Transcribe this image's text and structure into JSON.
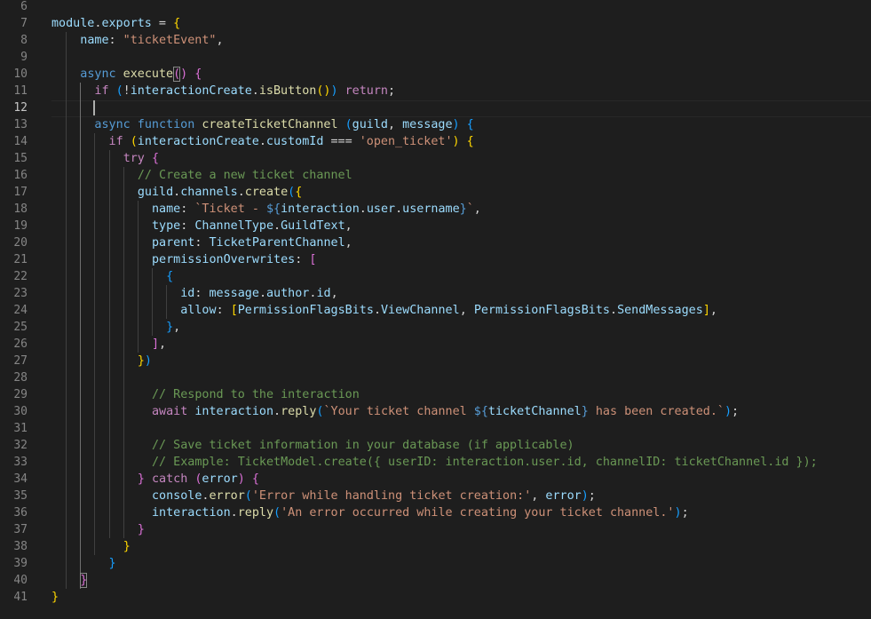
{
  "editor": {
    "theme_colors": {
      "background": "#1e1e1e",
      "keyword": "#569cd6",
      "control": "#c586c0",
      "function": "#dcdcaa",
      "string": "#ce9178",
      "variable": "#9cdcfe",
      "class": "#4ec9b0",
      "comment": "#6a9955",
      "bracket_level_1": "#ffd700",
      "bracket_level_2": "#da70d6",
      "bracket_level_3": "#179fff"
    },
    "active_line": 12,
    "lines": [
      {
        "n": "6",
        "indent": 0,
        "tokens": []
      },
      {
        "n": "7",
        "indent": 0,
        "tokens": [
          [
            "var",
            "module"
          ],
          [
            "op",
            "."
          ],
          [
            "var",
            "exports"
          ],
          [
            "op",
            " = "
          ],
          [
            "b1",
            "{"
          ]
        ]
      },
      {
        "n": "8",
        "indent": 4,
        "tokens": [
          [
            "var",
            "name"
          ],
          [
            "op",
            ": "
          ],
          [
            "str",
            "\"ticketEvent\""
          ],
          [
            "op",
            ","
          ]
        ]
      },
      {
        "n": "9",
        "indent": 0,
        "tokens": []
      },
      {
        "n": "10",
        "indent": 4,
        "tokens": [
          [
            "kw",
            "async"
          ],
          [
            "op",
            " "
          ],
          [
            "fn",
            "execute"
          ],
          [
            "b2",
            "()"
          ],
          [
            "op",
            " "
          ],
          [
            "b2",
            "{"
          ]
        ]
      },
      {
        "n": "11",
        "indent": 6,
        "tokens": [
          [
            "ctl",
            "if"
          ],
          [
            "op",
            " "
          ],
          [
            "b3",
            "("
          ],
          [
            "op",
            "!"
          ],
          [
            "var",
            "interactionCreate"
          ],
          [
            "op",
            "."
          ],
          [
            "fn",
            "isButton"
          ],
          [
            "b1",
            "()"
          ],
          [
            "b3",
            ")"
          ],
          [
            "op",
            " "
          ],
          [
            "ctl",
            "return"
          ],
          [
            "op",
            ";"
          ]
        ]
      },
      {
        "n": "12",
        "indent": 0,
        "tokens": []
      },
      {
        "n": "13",
        "indent": 6,
        "tokens": [
          [
            "kw",
            "async"
          ],
          [
            "op",
            " "
          ],
          [
            "kw",
            "function"
          ],
          [
            "op",
            " "
          ],
          [
            "fn",
            "createTicketChannel"
          ],
          [
            "op",
            " "
          ],
          [
            "b3",
            "("
          ],
          [
            "var",
            "guild"
          ],
          [
            "op",
            ", "
          ],
          [
            "var",
            "message"
          ],
          [
            "b3",
            ")"
          ],
          [
            "op",
            " "
          ],
          [
            "b3",
            "{"
          ]
        ]
      },
      {
        "n": "14",
        "indent": 8,
        "tokens": [
          [
            "ctl",
            "if"
          ],
          [
            "op",
            " "
          ],
          [
            "b1",
            "("
          ],
          [
            "var",
            "interactionCreate"
          ],
          [
            "op",
            "."
          ],
          [
            "var",
            "customId"
          ],
          [
            "op",
            " === "
          ],
          [
            "str",
            "'open_ticket'"
          ],
          [
            "b1",
            ")"
          ],
          [
            "op",
            " "
          ],
          [
            "b1",
            "{"
          ]
        ]
      },
      {
        "n": "15",
        "indent": 10,
        "tokens": [
          [
            "ctl",
            "try"
          ],
          [
            "op",
            " "
          ],
          [
            "b2",
            "{"
          ]
        ]
      },
      {
        "n": "16",
        "indent": 12,
        "tokens": [
          [
            "cmt",
            "// Create a new ticket channel"
          ]
        ]
      },
      {
        "n": "17",
        "indent": 12,
        "tokens": [
          [
            "var",
            "guild"
          ],
          [
            "op",
            "."
          ],
          [
            "var",
            "channels"
          ],
          [
            "op",
            "."
          ],
          [
            "fn",
            "create"
          ],
          [
            "b3",
            "("
          ],
          [
            "b1",
            "{"
          ]
        ]
      },
      {
        "n": "18",
        "indent": 14,
        "tokens": [
          [
            "var",
            "name"
          ],
          [
            "op",
            ": "
          ],
          [
            "str",
            "`Ticket - "
          ],
          [
            "kw",
            "${"
          ],
          [
            "var",
            "interaction"
          ],
          [
            "op",
            "."
          ],
          [
            "var",
            "user"
          ],
          [
            "op",
            "."
          ],
          [
            "var",
            "username"
          ],
          [
            "kw",
            "}"
          ],
          [
            "str",
            "`"
          ],
          [
            "op",
            ","
          ]
        ]
      },
      {
        "n": "19",
        "indent": 14,
        "tokens": [
          [
            "var",
            "type"
          ],
          [
            "op",
            ": "
          ],
          [
            "var",
            "ChannelType"
          ],
          [
            "op",
            "."
          ],
          [
            "var",
            "GuildText"
          ],
          [
            "op",
            ","
          ]
        ]
      },
      {
        "n": "20",
        "indent": 14,
        "tokens": [
          [
            "var",
            "parent"
          ],
          [
            "op",
            ": "
          ],
          [
            "var",
            "TicketParentChannel"
          ],
          [
            "op",
            ","
          ]
        ]
      },
      {
        "n": "21",
        "indent": 14,
        "tokens": [
          [
            "var",
            "permissionOverwrites"
          ],
          [
            "op",
            ": "
          ],
          [
            "b2",
            "["
          ]
        ]
      },
      {
        "n": "22",
        "indent": 16,
        "tokens": [
          [
            "b3",
            "{"
          ]
        ]
      },
      {
        "n": "23",
        "indent": 18,
        "tokens": [
          [
            "var",
            "id"
          ],
          [
            "op",
            ": "
          ],
          [
            "var",
            "message"
          ],
          [
            "op",
            "."
          ],
          [
            "var",
            "author"
          ],
          [
            "op",
            "."
          ],
          [
            "var",
            "id"
          ],
          [
            "op",
            ","
          ]
        ]
      },
      {
        "n": "24",
        "indent": 18,
        "tokens": [
          [
            "var",
            "allow"
          ],
          [
            "op",
            ": "
          ],
          [
            "b1",
            "["
          ],
          [
            "var",
            "PermissionFlagsBits"
          ],
          [
            "op",
            "."
          ],
          [
            "var",
            "ViewChannel"
          ],
          [
            "op",
            ", "
          ],
          [
            "var",
            "PermissionFlagsBits"
          ],
          [
            "op",
            "."
          ],
          [
            "var",
            "SendMessages"
          ],
          [
            "b1",
            "]"
          ],
          [
            "op",
            ","
          ]
        ]
      },
      {
        "n": "25",
        "indent": 16,
        "tokens": [
          [
            "b3",
            "}"
          ],
          [
            "op",
            ","
          ]
        ]
      },
      {
        "n": "26",
        "indent": 14,
        "tokens": [
          [
            "b2",
            "]"
          ],
          [
            "op",
            ","
          ]
        ]
      },
      {
        "n": "27",
        "indent": 12,
        "tokens": [
          [
            "b1",
            "}"
          ],
          [
            "b3",
            ")"
          ]
        ]
      },
      {
        "n": "28",
        "indent": 0,
        "tokens": []
      },
      {
        "n": "29",
        "indent": 14,
        "tokens": [
          [
            "cmt",
            "// Respond to the interaction"
          ]
        ]
      },
      {
        "n": "30",
        "indent": 14,
        "tokens": [
          [
            "ctl",
            "await"
          ],
          [
            "op",
            " "
          ],
          [
            "var",
            "interaction"
          ],
          [
            "op",
            "."
          ],
          [
            "fn",
            "reply"
          ],
          [
            "b3",
            "("
          ],
          [
            "str",
            "`Your ticket channel "
          ],
          [
            "kw",
            "${"
          ],
          [
            "var",
            "ticketChannel"
          ],
          [
            "kw",
            "}"
          ],
          [
            "str",
            " has been created.`"
          ],
          [
            "b3",
            ")"
          ],
          [
            "op",
            ";"
          ]
        ]
      },
      {
        "n": "31",
        "indent": 0,
        "tokens": []
      },
      {
        "n": "32",
        "indent": 14,
        "tokens": [
          [
            "cmt",
            "// Save ticket information in your database (if applicable)"
          ]
        ]
      },
      {
        "n": "33",
        "indent": 14,
        "tokens": [
          [
            "cmt",
            "// Example: TicketModel.create({ userID: interaction.user.id, channelID: ticketChannel.id });"
          ]
        ]
      },
      {
        "n": "34",
        "indent": 12,
        "tokens": [
          [
            "b2",
            "}"
          ],
          [
            "op",
            " "
          ],
          [
            "ctl",
            "catch"
          ],
          [
            "op",
            " "
          ],
          [
            "b2",
            "("
          ],
          [
            "var",
            "error"
          ],
          [
            "b2",
            ")"
          ],
          [
            "op",
            " "
          ],
          [
            "b2",
            "{"
          ]
        ]
      },
      {
        "n": "35",
        "indent": 14,
        "tokens": [
          [
            "var",
            "console"
          ],
          [
            "op",
            "."
          ],
          [
            "fn",
            "error"
          ],
          [
            "b3",
            "("
          ],
          [
            "str",
            "'Error while handling ticket creation:'"
          ],
          [
            "op",
            ", "
          ],
          [
            "var",
            "error"
          ],
          [
            "b3",
            ")"
          ],
          [
            "op",
            ";"
          ]
        ]
      },
      {
        "n": "36",
        "indent": 14,
        "tokens": [
          [
            "var",
            "interaction"
          ],
          [
            "op",
            "."
          ],
          [
            "fn",
            "reply"
          ],
          [
            "b3",
            "("
          ],
          [
            "str",
            "'An error occurred while creating your ticket channel.'"
          ],
          [
            "b3",
            ")"
          ],
          [
            "op",
            ";"
          ]
        ]
      },
      {
        "n": "37",
        "indent": 12,
        "tokens": [
          [
            "b2",
            "}"
          ]
        ]
      },
      {
        "n": "38",
        "indent": 10,
        "tokens": [
          [
            "b1",
            "}"
          ]
        ]
      },
      {
        "n": "39",
        "indent": 8,
        "tokens": [
          [
            "b3",
            "}"
          ]
        ]
      },
      {
        "n": "40",
        "indent": 4,
        "tokens": [
          [
            "b2",
            "}"
          ]
        ]
      },
      {
        "n": "41",
        "indent": 0,
        "tokens": [
          [
            "b1",
            "}"
          ]
        ]
      }
    ]
  }
}
